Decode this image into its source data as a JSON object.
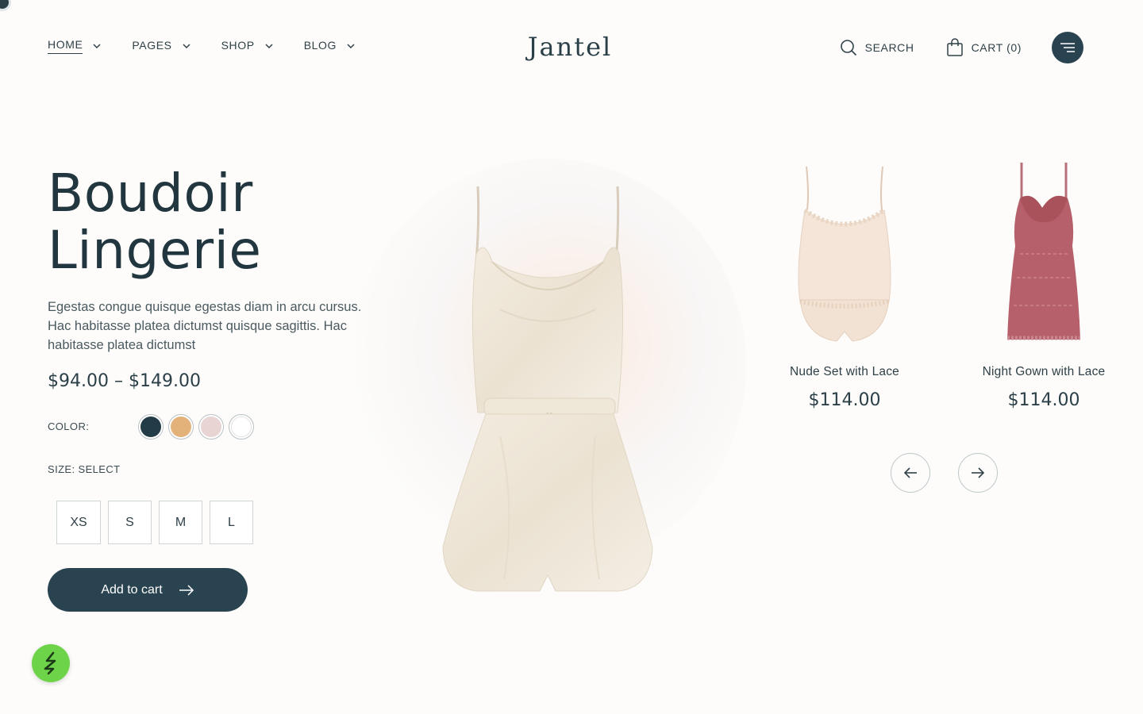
{
  "brand": {
    "logo": "Jantel"
  },
  "nav": {
    "items": [
      {
        "label": "HOME"
      },
      {
        "label": "PAGES"
      },
      {
        "label": "SHOP"
      },
      {
        "label": "BLOG"
      }
    ]
  },
  "header": {
    "search_label": "SEARCH",
    "cart_label": "CART (0)"
  },
  "hero": {
    "title_line1": "Boudoir",
    "title_line2": "Lingerie",
    "description": "Egestas congue quisque egestas diam in arcu cursus. Hac habitasse platea dictumst quisque sagittis. Hac habitasse platea dictumst",
    "price_range": "$94.00 – $149.00",
    "color_label": "COLOR:",
    "colors": [
      "#233b47",
      "#e2b27a",
      "#e8d4d2",
      "#ffffff"
    ],
    "size_label": "SIZE: SELECT",
    "sizes": [
      "XS",
      "S",
      "M",
      "L"
    ],
    "add_to_cart": "Add to cart"
  },
  "carousel": {
    "products": [
      {
        "name": "Nude Set with Lace",
        "price": "$114.00"
      },
      {
        "name": "Night Gown with Lace",
        "price": "$114.00"
      }
    ]
  }
}
